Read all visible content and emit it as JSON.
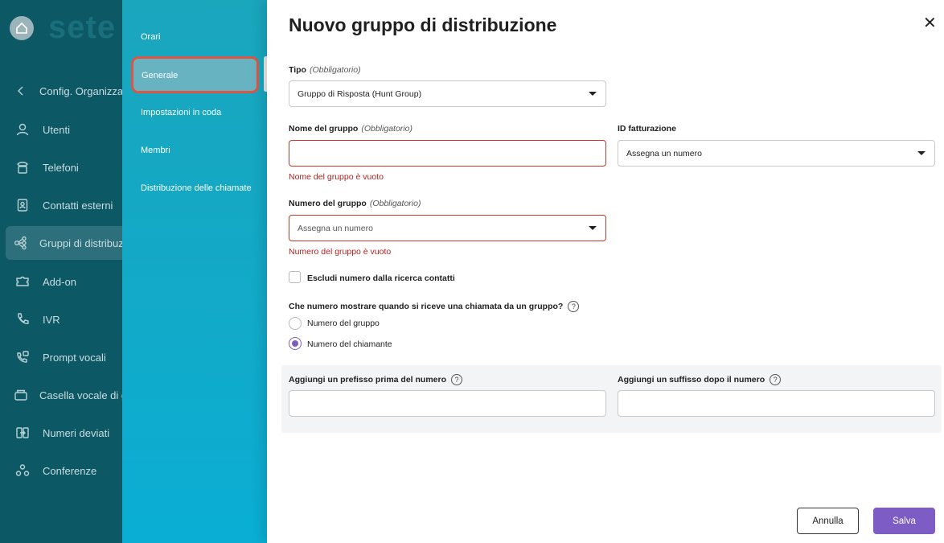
{
  "app": {
    "logo_text": "sete"
  },
  "sidebar": {
    "back_label": "Config. Organizzazione",
    "items": [
      {
        "label": "Utenti",
        "icon": "user-icon"
      },
      {
        "label": "Telefoni",
        "icon": "phone-icon"
      },
      {
        "label": "Contatti esterni",
        "icon": "contacts-icon"
      },
      {
        "label": "Gruppi di distribuzione",
        "icon": "group-icon",
        "active": true
      },
      {
        "label": "Add-on",
        "icon": "addon-icon"
      },
      {
        "label": "IVR",
        "icon": "ivr-icon"
      },
      {
        "label": "Prompt vocali",
        "icon": "prompt-icon"
      },
      {
        "label": "Casella vocale di gruppo",
        "icon": "voicemail-icon"
      },
      {
        "label": "Numeri deviati",
        "icon": "forward-icon"
      },
      {
        "label": "Conferenze",
        "icon": "conference-icon"
      }
    ]
  },
  "submenu": {
    "items": [
      "Orari",
      "Generale",
      "Impostazioni in coda",
      "Membri",
      "Distribuzione delle chiamate"
    ],
    "active": "Generale"
  },
  "drawer": {
    "title": "Nuovo gruppo di distribuzione",
    "required_tag": "(Obbligatorio)",
    "tipo": {
      "label": "Tipo",
      "value": "Gruppo di Risposta (Hunt Group)"
    },
    "nome": {
      "label": "Nome del gruppo",
      "value": "",
      "error": "Nome del gruppo è vuoto"
    },
    "id_fatturazione": {
      "label": "ID fatturazione",
      "value": "Assegna un numero"
    },
    "numero": {
      "label": "Numero del gruppo",
      "placeholder": "Assegna un numero",
      "error": "Numero del gruppo è vuoto"
    },
    "escludi": {
      "label": "Escludi numero dalla ricerca contatti",
      "checked": false
    },
    "display_question": "Che numero mostrare quando si riceve una chiamata da un gruppo?",
    "radio_options": [
      "Numero del gruppo",
      "Numero del chiamante"
    ],
    "radio_selected": "Numero del chiamante",
    "prefisso": {
      "label": "Aggiungi un prefisso prima del numero",
      "value": ""
    },
    "suffisso": {
      "label": "Aggiungi un suffisso dopo il numero",
      "value": ""
    },
    "help_glyph": "?",
    "cancel_label": "Annulla",
    "save_label": "Salva",
    "close_glyph": "✕"
  },
  "colors": {
    "accent": "#7d5cc6",
    "sidebar": "#0d5865",
    "submenu": "#11aac9",
    "error": "#b22222"
  }
}
